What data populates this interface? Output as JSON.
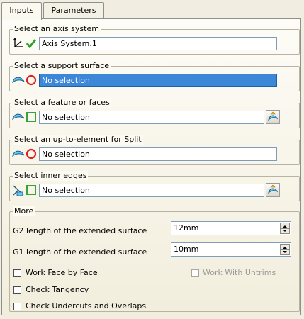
{
  "tabs": [
    "Inputs",
    "Parameters"
  ],
  "groups": {
    "axis": {
      "title": "Select an axis system",
      "value": "Axis System.1"
    },
    "support": {
      "title": "Select a support surface",
      "value": "No selection"
    },
    "feature": {
      "title": "Select a feature or faces",
      "value": "No selection"
    },
    "split": {
      "title": "Select an up-to-element for Split",
      "value": "No selection"
    },
    "edges": {
      "title": "Select inner edges",
      "value": "No selection"
    },
    "more": {
      "title": "More",
      "g2_label": "G2 length of the extended surface",
      "g2_value": "12mm",
      "g1_label": "G1 length of the extended surface",
      "g1_value": "10mm",
      "work_face": "Work Face by Face",
      "work_untrims": "Work With Untrims",
      "check_tangency": "Check Tangency",
      "check_undercuts": "Check Undercuts and Overlaps"
    }
  },
  "colors": {
    "selected": "#3d87d8",
    "panel": "#f1eee1",
    "check_green": "#2aa02a",
    "circle_red": "#e02020"
  }
}
